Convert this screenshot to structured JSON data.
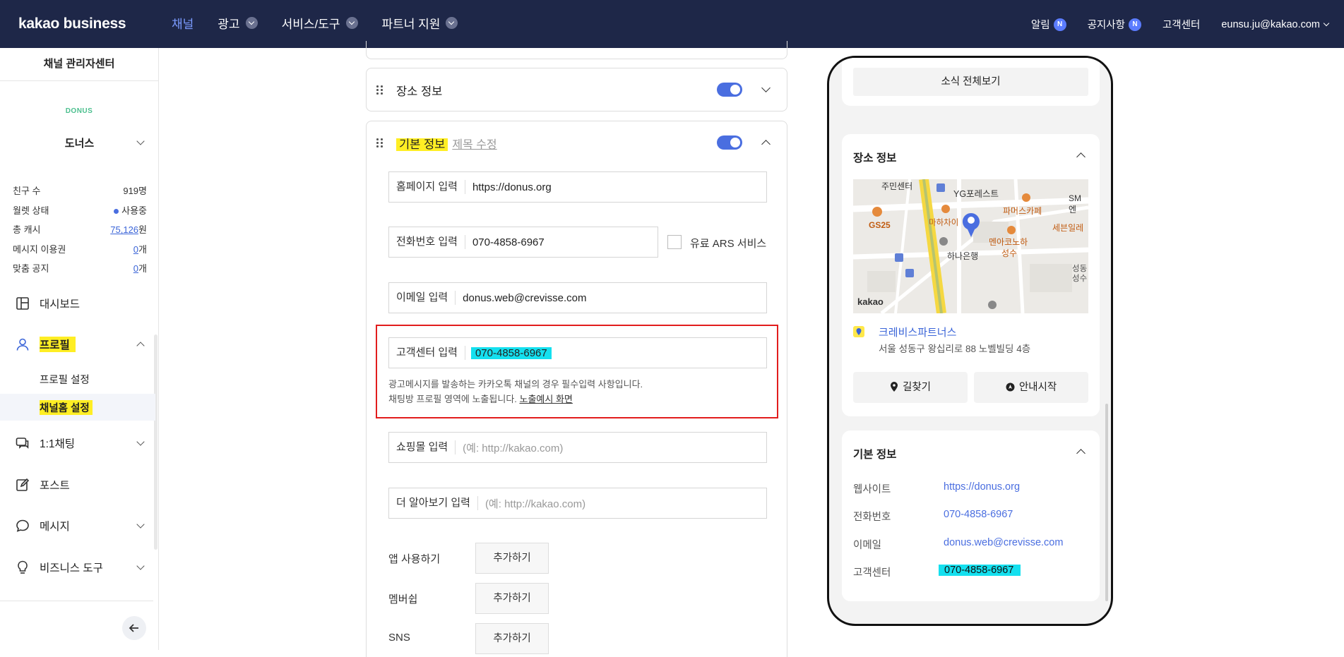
{
  "topbar": {
    "logo": "kakao business",
    "nav": [
      {
        "label": "채널",
        "active": true,
        "has_menu": false
      },
      {
        "label": "광고",
        "active": false,
        "has_menu": true
      },
      {
        "label": "서비스/도구",
        "active": false,
        "has_menu": true
      },
      {
        "label": "파트너 지원",
        "active": false,
        "has_menu": true
      }
    ],
    "alerts_label": "알림",
    "alerts_badge": "N",
    "notice_label": "공지사항",
    "notice_badge": "N",
    "support_label": "고객센터",
    "account": "eunsu.ju@kakao.com"
  },
  "sidebar": {
    "title": "채널 관리자센터",
    "channel_logo_text": "DONUS",
    "channel_name": "도너스",
    "stats": [
      {
        "label": "친구 수",
        "value": "919명"
      },
      {
        "label": "월렛 상태",
        "value": "사용중"
      },
      {
        "label": "총 캐시",
        "value": "75,126",
        "unit": "원"
      },
      {
        "label": "메시지 이용권",
        "value": "0",
        "unit": "개"
      },
      {
        "label": "맞춤 공지",
        "value": "0",
        "unit": "개"
      }
    ],
    "menu": {
      "dashboard": "대시보드",
      "profile": "프로필",
      "profile_settings": "프로필 설정",
      "channel_home_settings": "채널홈 설정",
      "chat": "1:1채팅",
      "post": "포스트",
      "message": "메시지",
      "business_tools": "비즈니스 도구"
    }
  },
  "main": {
    "place_section": {
      "title": "장소 정보",
      "enabled": true
    },
    "basic_section": {
      "title": "기본 정보",
      "edit_title": "제목 수정",
      "enabled": true,
      "homepage": {
        "label": "홈페이지 입력",
        "value": "https://donus.org"
      },
      "phone": {
        "label": "전화번호 입력",
        "value": "070-4858-6967",
        "ars_label": "유료 ARS 서비스"
      },
      "email": {
        "label": "이메일 입력",
        "value": "donus.web@crevisse.com"
      },
      "customer_center": {
        "label": "고객센터 입력",
        "value": "070-4858-6967",
        "help_line1": "광고메시지를 발송하는 카카오톡 채널의 경우 필수입력 사항입니다.",
        "help_line2": "채팅방 프로필 영역에 노출됩니다. ",
        "help_link": "노출예시 화면"
      },
      "shopping": {
        "label": "쇼핑몰 입력",
        "placeholder": "(예: http://kakao.com)"
      },
      "more": {
        "label": "더 알아보기 입력",
        "placeholder": "(예: http://kakao.com)"
      },
      "app": {
        "label": "앱 사용하기",
        "button": "추가하기"
      },
      "membership": {
        "label": "멤버쉽",
        "button": "추가하기"
      },
      "sns": {
        "label": "SNS",
        "button": "추가하기"
      }
    }
  },
  "preview": {
    "news_all": "소식 전체보기",
    "place_title": "장소 정보",
    "map_labels": {
      "l1": "주민센터",
      "l2": "YG포레스트",
      "l3": "SM엔",
      "l4": "마하차이",
      "l5": "파머스카페",
      "l6": "GS25",
      "l7": "세븐일레",
      "l8": "멘아코노하",
      "l9": "성수",
      "l10": "하나은행",
      "l11": "성동",
      "l12": "성수",
      "l13": "kakao"
    },
    "place_name": "크레비스파트너스",
    "place_address": "서울 성동구 왕십리로 88 노벨빌딩 4층",
    "directions": "길찾기",
    "navigate": "안내시작",
    "basic_title": "기본 정보",
    "info": [
      {
        "label": "웹사이트",
        "value": "https://donus.org"
      },
      {
        "label": "전화번호",
        "value": "070-4858-6967"
      },
      {
        "label": "이메일",
        "value": "donus.web@crevisse.com"
      },
      {
        "label": "고객센터",
        "value": "070-4858-6967"
      }
    ]
  },
  "colors": {
    "topbar_bg": "#1e2748",
    "accent": "#4a6ee0",
    "highlight_yellow": "#ffee24",
    "highlight_cyan": "#14e0ef",
    "annotation_red": "#e21d1d"
  }
}
